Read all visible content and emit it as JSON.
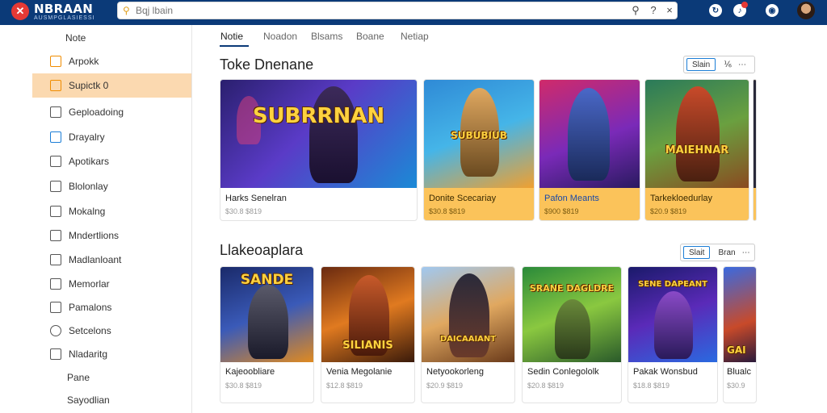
{
  "header": {
    "brand": "NBRAAN",
    "brand_sub": "AUSMPGLASIESSI",
    "search_placeholder": "Bqj lbain",
    "icons": [
      "search-icon",
      "help-icon",
      "close-icon",
      "refresh-icon",
      "notifications-icon",
      "settings-icon",
      "avatar"
    ]
  },
  "sidebar": {
    "top_label": "Note",
    "items": [
      {
        "label": "Arpokk",
        "icon": "home-icon"
      },
      {
        "label": "Supictk 0",
        "icon": "store-icon",
        "active": true
      },
      {
        "label": "Geploadoing",
        "icon": "download-icon"
      },
      {
        "label": "Drayalry",
        "icon": "library-icon"
      },
      {
        "label": "Apotikars",
        "icon": "folder-icon"
      },
      {
        "label": "Blolonlay",
        "icon": "document-icon"
      },
      {
        "label": "Mokalng",
        "icon": "mail-icon"
      },
      {
        "label": "Mndertlions",
        "icon": "grid-icon"
      },
      {
        "label": "Madlanloant",
        "icon": "bookmark-icon"
      },
      {
        "label": "Memorlar",
        "icon": "chat-icon"
      },
      {
        "label": "Pamalons",
        "icon": "calendar-icon"
      },
      {
        "label": "Setcelons",
        "icon": "clock-icon"
      },
      {
        "label": "Nladaritg",
        "icon": "info-icon"
      }
    ],
    "bottom_labels": [
      "Pane",
      "Sayodlian"
    ]
  },
  "tabs": [
    "Notie",
    "Noadon",
    "Blsams",
    "Boane",
    "Netiap"
  ],
  "section1": {
    "title": "Toke Dnenane",
    "control_pill": "Slain",
    "control_ext": "⅙",
    "cards": [
      {
        "art_title": "SUBRRNAN",
        "title": "Harks Senelran",
        "price": "$30.8 $819"
      },
      {
        "art_title": "SUBUBIUB",
        "title": "Donite Scecariay",
        "price": "$30.8 $819"
      },
      {
        "art_title": "",
        "title": "Pafon Meants",
        "price": "$900 $819"
      },
      {
        "art_title": "MAIEHNAR",
        "title": "Tarkekloedurlay",
        "price": "$20.9 $819"
      }
    ]
  },
  "section2": {
    "title": "Llakeoaplara",
    "control_pill": "Slait",
    "control_ext": "Bran",
    "cards": [
      {
        "art_title": "SANDE",
        "title": "Kajeoobliare",
        "price": "$30.8 $819"
      },
      {
        "art_title": "SILIANIS",
        "title": "Venia Megolanie",
        "price": "$12.8 $819"
      },
      {
        "art_title": "DAICAAIANT",
        "title": "Netyookorleng",
        "price": "$20.9 $819"
      },
      {
        "art_title": "SRANE DAGLDRE",
        "title": "Sedin Conlegololk",
        "price": "$20.8 $819"
      },
      {
        "art_title": "SENE DAPEANT",
        "title": "Pakak Wonsbud",
        "price": "$18.8 $819"
      },
      {
        "art_title": "GAI",
        "title": "Blualc",
        "price": "$30.9"
      }
    ]
  },
  "colors": {
    "header": "#0b3a78",
    "active_sidebar": "#fbd9b0",
    "gold_card": "#fbc35a",
    "accent": "#1c7ed6"
  }
}
